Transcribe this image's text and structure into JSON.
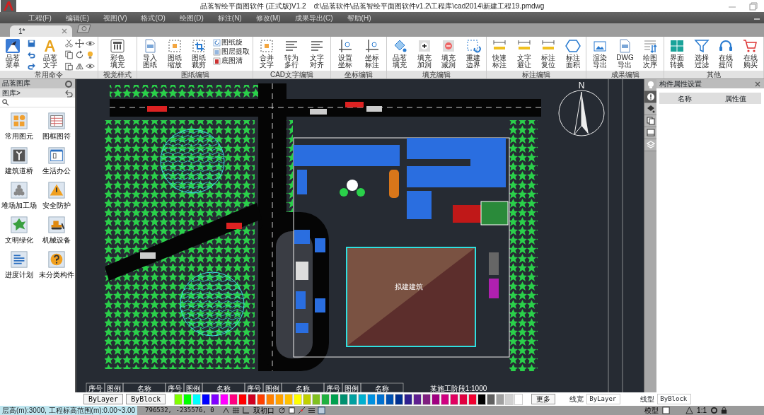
{
  "window": {
    "title": "品茗智绘平面图软件 (正式版)V1.2",
    "file_path": "d:\\品茗软件\\品茗智绘平面图软件v1.2\\工程库\\cad2014\\新建工程19.pmdwg"
  },
  "menu": [
    "工程(F)",
    "编辑(E)",
    "视图(V)",
    "格式(O)",
    "绘图(D)",
    "标注(N)",
    "修改(M)",
    "成果导出(C)",
    "帮助(H)"
  ],
  "tabs": [
    {
      "label": "1*",
      "selected": true
    }
  ],
  "ribbon": [
    {
      "group": "常用命令",
      "items": [
        {
          "kind": "large",
          "label": "品茗菜单"
        },
        {
          "kind": "quick-access"
        },
        {
          "kind": "large",
          "label": "品茗文字"
        },
        {
          "kind": "edit-tools"
        }
      ]
    },
    {
      "group": "视觉样式",
      "items": [
        {
          "kind": "large",
          "label": "彩色填充"
        }
      ]
    },
    {
      "group": "图纸编辑",
      "items": [
        {
          "kind": "large",
          "label": "导入图纸"
        },
        {
          "kind": "large",
          "label": "图纸缩放"
        },
        {
          "kind": "large",
          "label": "图纸裁剪"
        },
        {
          "kind": "list",
          "labels": [
            "图纸旋",
            "图层提取",
            "底图清"
          ]
        }
      ]
    },
    {
      "group": "CAD文字编辑",
      "items": [
        {
          "kind": "large",
          "label": "合并文字"
        },
        {
          "kind": "large",
          "label": "转为多行"
        },
        {
          "kind": "large",
          "label": "文字对齐"
        }
      ]
    },
    {
      "group": "坐标编辑",
      "items": [
        {
          "kind": "large",
          "label": "设置坐标"
        },
        {
          "kind": "large",
          "label": "坐标标注"
        }
      ]
    },
    {
      "group": "填充编辑",
      "items": [
        {
          "kind": "large",
          "label": "品茗填充"
        },
        {
          "kind": "large",
          "label": "填充加洞"
        },
        {
          "kind": "large",
          "label": "填充减洞"
        },
        {
          "kind": "large",
          "label": "重建边界"
        }
      ]
    },
    {
      "group": "标注编辑",
      "items": [
        {
          "kind": "large",
          "label": "快速标注"
        },
        {
          "kind": "large",
          "label": "文字避让"
        },
        {
          "kind": "large",
          "label": "标注复位"
        },
        {
          "kind": "large",
          "label": "标注面积"
        }
      ]
    },
    {
      "group": "成果编辑",
      "items": [
        {
          "kind": "large",
          "label": "渲染导出"
        },
        {
          "kind": "large",
          "label": "DWG导出"
        },
        {
          "kind": "large",
          "label": "绘图次序"
        }
      ]
    },
    {
      "group": "其他",
      "items": [
        {
          "kind": "large",
          "label": "界面转换"
        },
        {
          "kind": "large",
          "label": "选择过滤"
        },
        {
          "kind": "large",
          "label": "在线提问"
        },
        {
          "kind": "large",
          "label": "在线购买"
        }
      ]
    }
  ],
  "library": {
    "title": "品茗图库",
    "breadcrumb": "图库>",
    "items": [
      "常用图元",
      "图框图符",
      "建筑道桥",
      "生活办公",
      "堆场加工场",
      "安全防护",
      "文明绿化",
      "机械设备",
      "进度计划",
      "未分类构件"
    ]
  },
  "drawing": {
    "north": "N",
    "building_label": "拟建建筑",
    "legend_headers": [
      "序号",
      "图例",
      "名称",
      "序号",
      "图例",
      "名称",
      "序号",
      "图例",
      "名称",
      "序号",
      "图例",
      "名称"
    ],
    "plan_title": "某施工阶段1:1000"
  },
  "side_tools": [
    {
      "selected": false
    },
    {
      "selected": true
    },
    {
      "selected": false
    },
    {
      "selected": false
    },
    {
      "selected": false
    },
    {
      "selected": false
    }
  ],
  "properties": {
    "title": "构件属性设置",
    "columns": [
      "名称",
      "属性值"
    ]
  },
  "color_bar": {
    "bylayer": "ByLayer",
    "byblock": "ByBlock",
    "more": "更多",
    "line_weight_label": "线宽",
    "line_weight": "ByLayer",
    "line_type_label": "线型",
    "line_type": "ByBlock",
    "swatches": [
      {
        "color": "#80ff00"
      },
      {
        "color": "#00ff00"
      },
      {
        "color": "#00ffff"
      },
      {
        "color": "#0000ff"
      },
      {
        "color": "#8000ff"
      },
      {
        "color": "#ff00ff"
      },
      {
        "color": "#ff0080"
      },
      {
        "color": "#ff0000"
      },
      {
        "color": "#d00020"
      },
      {
        "color": "#ff4000"
      },
      {
        "color": "#ff8000"
      },
      {
        "color": "#ffa000"
      },
      {
        "color": "#ffc000"
      },
      {
        "color": "#ffff00"
      },
      {
        "color": "#c0d000"
      },
      {
        "color": "#80c020"
      },
      {
        "color": "#20b040"
      },
      {
        "color": "#00a050"
      },
      {
        "color": "#009070"
      },
      {
        "color": "#00a0a0"
      },
      {
        "color": "#00b0d0"
      },
      {
        "color": "#0090e0"
      },
      {
        "color": "#0070d0"
      },
      {
        "color": "#0050b0"
      },
      {
        "color": "#003090"
      },
      {
        "color": "#302090"
      },
      {
        "color": "#602090"
      },
      {
        "color": "#802080"
      },
      {
        "color": "#a00080"
      },
      {
        "color": "#d00080"
      },
      {
        "color": "#e00060"
      },
      {
        "color": "#e00040"
      },
      {
        "color": "#f00030"
      },
      {
        "color": "#000000"
      },
      {
        "color": "#606060"
      },
      {
        "color": "#a0a0a0"
      },
      {
        "color": "#d0d0d0"
      },
      {
        "color": "#ffffff"
      }
    ]
  },
  "status_bar": {
    "level_info": "层高(m):3000, 工程标高范围(m):0.00~3.00",
    "coordinates": "796532, -235576, 0",
    "viewport": "双初口",
    "space": "模型",
    "scale": "1:1"
  }
}
